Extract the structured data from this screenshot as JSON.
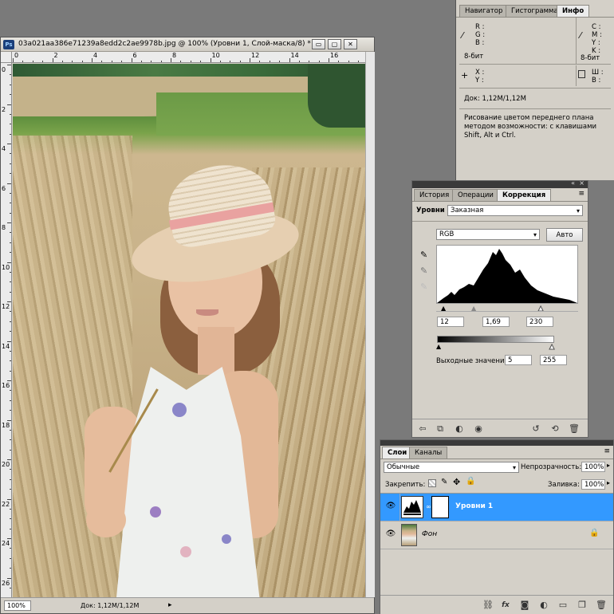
{
  "document": {
    "title": "03a021aa386e71239a8edd2c2ae9978b.jpg @ 100% (Уровни 1, Слой-маска/8) *",
    "app_icon": "Ps",
    "window_buttons": [
      "▭",
      "▢",
      "✕"
    ],
    "ruler_top": [
      "0",
      "2",
      "4",
      "6",
      "8",
      "10",
      "12",
      "14",
      "16"
    ],
    "ruler_left": [
      "0",
      "2",
      "4",
      "6",
      "8",
      "10",
      "12",
      "14",
      "16",
      "18",
      "20",
      "22",
      "24",
      "26"
    ],
    "zoom": "100%",
    "doc_size": "Док: 1,12M/1,12M"
  },
  "info_panel": {
    "tabs": [
      "Навигатор",
      "Гистограмма",
      "Инфо"
    ],
    "active_tab": "Инфо",
    "rgb_labels": [
      "R :",
      "G :",
      "B :"
    ],
    "cmyk_labels": [
      "C :",
      "M :",
      "Y :",
      "K :"
    ],
    "bit_left": "8-бит",
    "bit_right": "8-бит",
    "xy_labels": [
      "X :",
      "Y :"
    ],
    "wh_labels": [
      "Ш :",
      "В :"
    ],
    "doc": "Док: 1,12M/1,12M",
    "hint": "Рисование цветом переднего плана методом возможности: с клавишами Shift, Alt и Ctrl."
  },
  "correction_panel": {
    "tabs": [
      "История",
      "Операции",
      "Коррекция"
    ],
    "active_tab": "Коррекция",
    "levels_label": "Уровни",
    "preset": "Заказная",
    "channel": "RGB",
    "auto_button": "Авто",
    "input_black": "12",
    "input_gamma": "1,69",
    "input_white": "230",
    "output_label": "Выходные значения:",
    "output_black": "5",
    "output_white": "255"
  },
  "layers_panel": {
    "tabs": [
      "Слои",
      "Каналы"
    ],
    "active_tab": "Слои",
    "blend_mode": "Обычные",
    "opacity_label": "Непрозрачность:",
    "opacity": "100%",
    "lock_label": "Закрепить:",
    "fill_label": "Заливка:",
    "fill": "100%",
    "layers": [
      {
        "name": "Уровни 1",
        "selected": true
      },
      {
        "name": "Фон",
        "selected": false,
        "locked": true
      }
    ],
    "bottom_icons": [
      "link-icon",
      "fx-icon",
      "mask-icon",
      "adjustment-icon",
      "group-icon",
      "new-layer-icon",
      "trash-icon"
    ]
  },
  "colors": {
    "selection": "#3399ff",
    "panel_bg": "#d4d0c8",
    "workspace": "#7a7a7a"
  }
}
